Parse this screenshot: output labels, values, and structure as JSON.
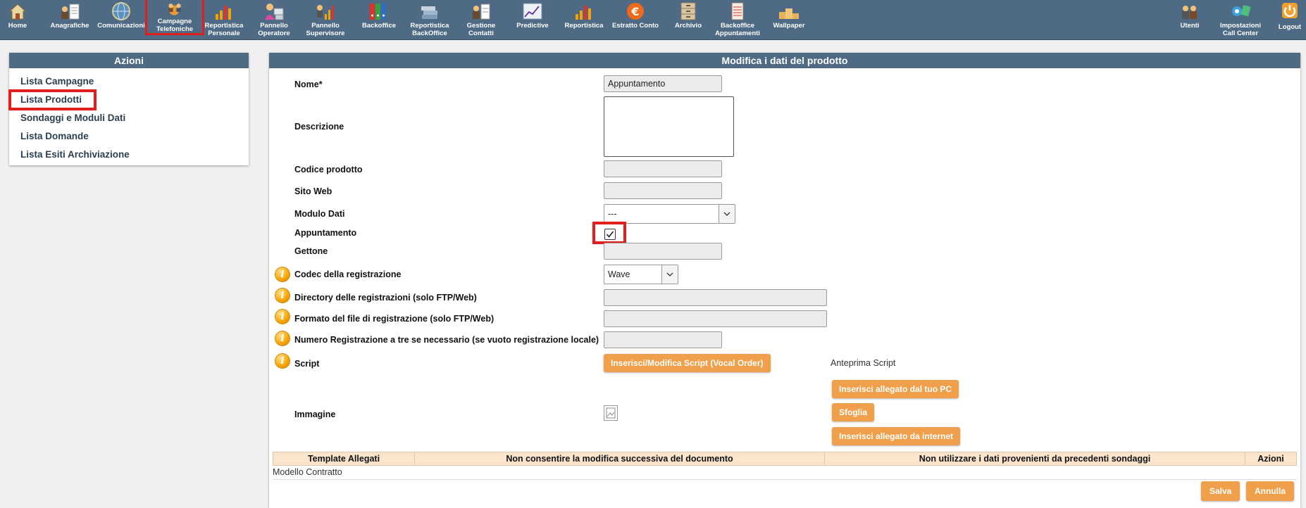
{
  "nav": {
    "items": [
      {
        "label": "Home",
        "icon": "home-icon"
      },
      {
        "label": "Anagrafiche",
        "icon": "anagrafiche-icon"
      },
      {
        "label": "Comunicazioni",
        "icon": "globe-icon"
      },
      {
        "label": "Campagne\nTelefoniche",
        "icon": "campaign-icon"
      },
      {
        "label": "Reportistica\nPersonale",
        "icon": "bar-chart-icon"
      },
      {
        "label": "Pannello\nOperatore",
        "icon": "operator-icon"
      },
      {
        "label": "Pannello\nSupervisore",
        "icon": "supervisor-icon"
      },
      {
        "label": "Backoffice",
        "icon": "binders-icon"
      },
      {
        "label": "Reportistica\nBackOffice",
        "icon": "books-icon"
      },
      {
        "label": "Gestione\nContatti",
        "icon": "contacts-icon"
      },
      {
        "label": "Predictive",
        "icon": "trend-chart-icon"
      },
      {
        "label": "Reportistica",
        "icon": "bar-chart-icon"
      },
      {
        "label": "Estratto Conto",
        "icon": "euro-icon"
      },
      {
        "label": "Archivio",
        "icon": "archive-icon"
      },
      {
        "label": "Backoffice\nAppuntamenti",
        "icon": "notebook-icon"
      },
      {
        "label": "Wallpaper",
        "icon": "podium-icon"
      }
    ],
    "right_items": [
      {
        "label": "Utenti",
        "icon": "users-icon"
      },
      {
        "label": "Impostazioni\nCall Center",
        "icon": "settings-icon"
      },
      {
        "label": "Logout",
        "icon": "power-icon"
      }
    ]
  },
  "left_panel": {
    "title": "Azioni",
    "items": [
      "Lista Campagne",
      "Lista Prodotti",
      "Sondaggi e Moduli Dati",
      "Lista Domande",
      "Lista Esiti Archiviazione"
    ]
  },
  "form": {
    "title": "Modifica i dati del prodotto",
    "nome_label": "Nome*",
    "nome_value": "Appuntamento",
    "descrizione_label": "Descrizione",
    "descrizione_value": "",
    "codice_label": "Codice prodotto",
    "codice_value": "",
    "sito_label": "Sito Web",
    "sito_value": "",
    "modulo_label": "Modulo Dati",
    "modulo_value": "---",
    "appuntamento_label": "Appuntamento",
    "appuntamento_checked": true,
    "gettone_label": "Gettone",
    "gettone_value": "",
    "codec_label": "Codec della registrazione",
    "codec_value": "Wave",
    "directory_label": "Directory delle registrazioni (solo FTP/Web)",
    "directory_value": "",
    "formato_label": "Formato del file di registrazione (solo FTP/Web)",
    "formato_value": "",
    "numero_label": "Numero Registrazione a tre se necessario (se vuoto registrazione locale)",
    "numero_value": "",
    "script_label": "Script",
    "script_button": "Inserisci/Modifica Script (Vocal Order)",
    "anteprima_label": "Anteprima Script",
    "immagine_label": "Immagine",
    "btn_allegato_pc": "Inserisci allegato dal tuo PC",
    "btn_sfoglia": "Sfoglia",
    "btn_allegato_internet": "Inserisci allegato da internet"
  },
  "table": {
    "headers": [
      "Template Allegati",
      "Non consentire la modifica successiva del documento",
      "Non utilizzare i dati provenienti da precedenti sondaggi",
      "Azioni"
    ],
    "rows": [
      "Modello Contratto"
    ]
  },
  "actions": {
    "save": "Salva",
    "cancel": "Annulla"
  },
  "colors": {
    "header_bg": "#4e6a85",
    "button_orange": "#f0a04b",
    "highlight_red": "#e41d1d",
    "table_header_bg": "#fbe5cc"
  }
}
